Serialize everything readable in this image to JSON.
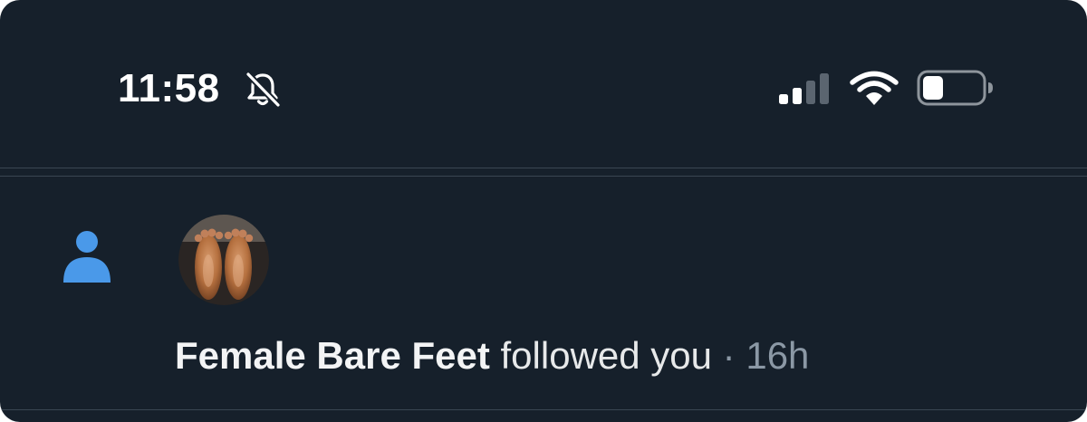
{
  "status_bar": {
    "time": "11:58",
    "mute_icon": "bell-slash-icon",
    "cellular_icon": "cellular-signal-icon",
    "cellular_bars_filled": 2,
    "cellular_bars_total": 4,
    "wifi_icon": "wifi-icon",
    "battery_icon": "battery-icon",
    "battery_level": 0.35
  },
  "notification": {
    "type_icon": "person-icon",
    "avatar": "profile-avatar-feet",
    "name": "Female Bare Feet",
    "action": "followed you",
    "separator": "·",
    "time_ago": "16h"
  },
  "colors": {
    "background": "#16202b",
    "accent": "#4a99e9",
    "text_primary": "#e7e9ea",
    "text_secondary": "#8b98a5",
    "divider": "#3a4652"
  }
}
